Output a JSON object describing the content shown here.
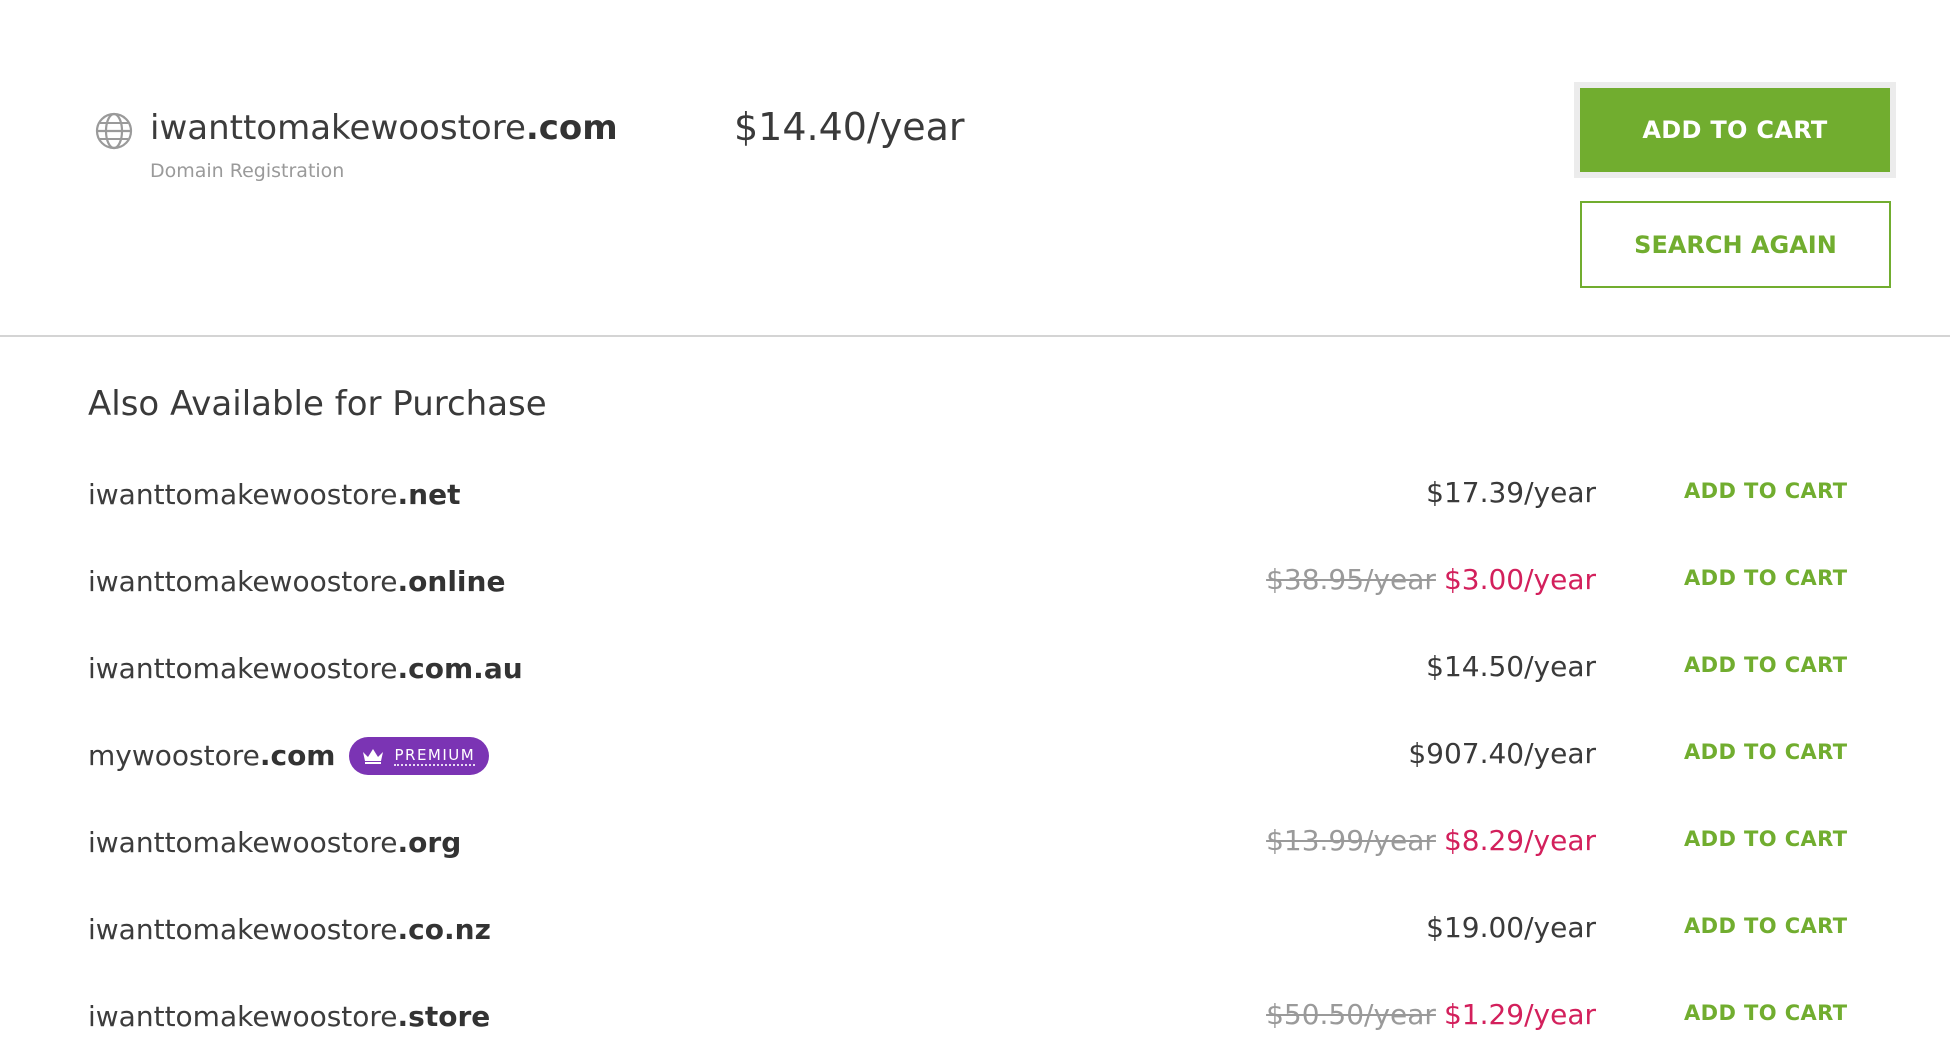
{
  "main": {
    "domain_base": "iwanttomakewoostore",
    "domain_tld": ".com",
    "subtitle": "Domain Registration",
    "price": "$14.40/year",
    "add_label": "ADD TO CART",
    "search_label": "SEARCH AGAIN",
    "icon": "globe-icon"
  },
  "also": {
    "title": "Also Available for Purchase",
    "cart_label": "ADD TO CART",
    "items": [
      {
        "base": "iwanttomakewoostore",
        "tld": ".net",
        "price": "$17.39/year",
        "old": "",
        "sale": ""
      },
      {
        "base": "iwanttomakewoostore",
        "tld": ".online",
        "price": "",
        "old": "$38.95/year",
        "sale": "$3.00/year"
      },
      {
        "base": "iwanttomakewoostore",
        "tld": ".com.au",
        "price": "$14.50/year",
        "old": "",
        "sale": ""
      },
      {
        "base": "mywoostore",
        "tld": ".com",
        "price": "$907.40/year",
        "old": "",
        "sale": "",
        "badge": "PREMIUM"
      },
      {
        "base": "iwanttomakewoostore",
        "tld": ".org",
        "price": "",
        "old": "$13.99/year",
        "sale": "$8.29/year"
      },
      {
        "base": "iwanttomakewoostore",
        "tld": ".co.nz",
        "price": "$19.00/year",
        "old": "",
        "sale": ""
      },
      {
        "base": "iwanttomakewoostore",
        "tld": ".store",
        "price": "",
        "old": "$50.50/year",
        "sale": "$1.29/year"
      }
    ]
  },
  "colors": {
    "accent": "#71ad2f",
    "sale": "#d3205c",
    "premium": "#7b34b4"
  }
}
